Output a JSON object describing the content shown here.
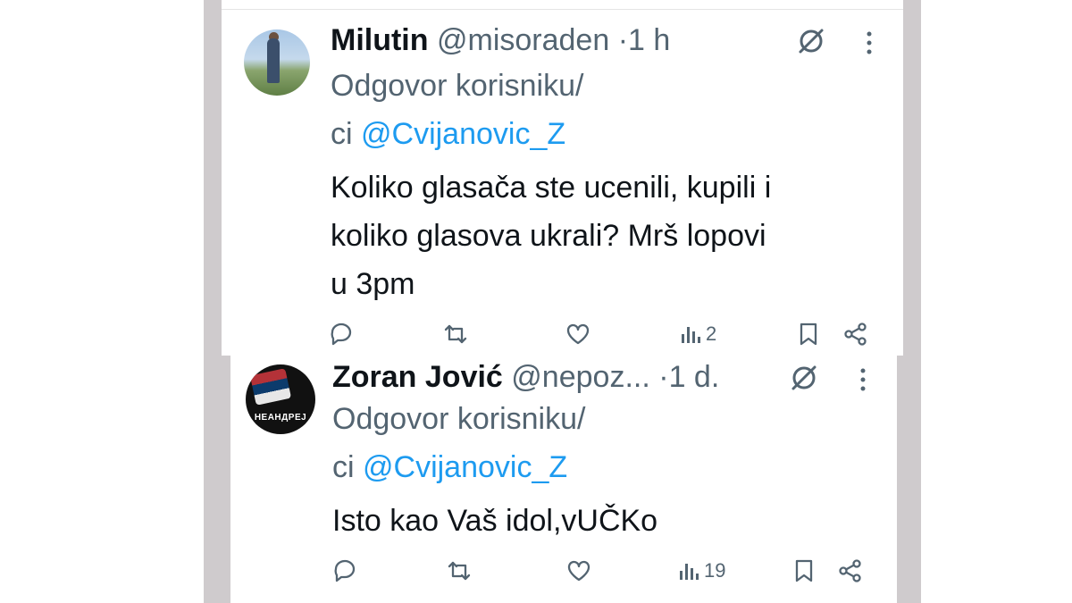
{
  "tweets": [
    {
      "name": "Milutin",
      "handle": "@misoraden",
      "separator": "·",
      "time": "1 h",
      "reply_prefix": "Odgovor korisniku/",
      "reply_ci": "ci ",
      "reply_mention": "@Cvijanovic_Z",
      "text_lines": [
        "Koliko glasača ste ucenili, kupili i",
        "koliko glasova ukrali? Mrš lopovi",
        "u 3pm"
      ],
      "views": "2",
      "icons": [
        "reply-icon",
        "retweet-icon",
        "like-icon",
        "views-icon",
        "bookmark-icon",
        "share-icon"
      ]
    },
    {
      "name": "Zoran Jović",
      "handle": "@nepoz...",
      "separator": "·",
      "time": "1 d.",
      "reply_prefix": "Odgovor korisniku/",
      "reply_ci": "ci ",
      "reply_mention": "@Cvijanovic_Z",
      "text_lines": [
        "Isto kao Vaš idol,vUČKo"
      ],
      "views": "19",
      "avatar_caption": "НЕАНДРЕЈ",
      "icons": [
        "reply-icon",
        "retweet-icon",
        "like-icon",
        "views-icon",
        "bookmark-icon",
        "share-icon"
      ]
    }
  ],
  "colors": {
    "text": "#0f1419",
    "secondary": "#536471",
    "link": "#1d9bf0",
    "frame": "#cfcbcd"
  }
}
